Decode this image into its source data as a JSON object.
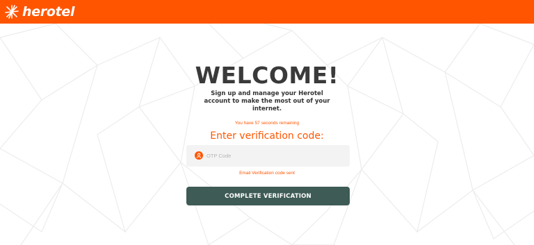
{
  "brand": {
    "name": "herotel",
    "accent": "#ff5500",
    "button_color": "#3e5b55"
  },
  "header": {
    "logo_icon": "herotel-star-icon"
  },
  "main": {
    "title": "WELCOME!",
    "subtitle": "Sign up and manage your Herotel account to make the most out of your internet.",
    "timer_text": "You have 57 seconds remaining",
    "prompt": "Enter verification code:",
    "otp": {
      "placeholder": "OTP Code",
      "value": "",
      "icon": "user-icon"
    },
    "status_message": "Email Verification code sent",
    "submit_label": "COMPLETE VERIFICATION"
  }
}
